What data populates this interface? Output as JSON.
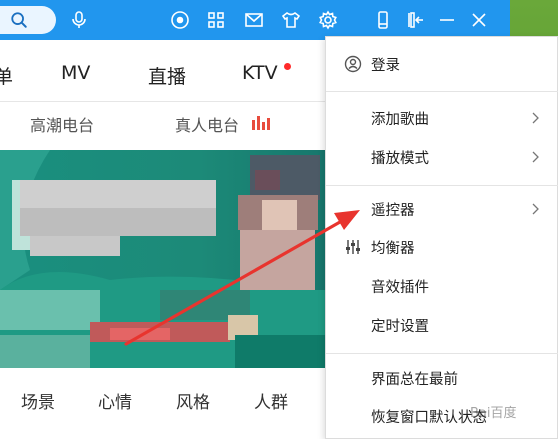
{
  "topbar": {
    "icons": [
      "search-icon",
      "mic-icon",
      "play-circle-icon",
      "grid-apps-icon",
      "mail-icon",
      "tshirt-skin-icon",
      "gear-icon",
      "phone-icon",
      "mini-mode-icon",
      "minimize-icon",
      "close-icon"
    ]
  },
  "nav": {
    "items": [
      "单",
      "MV",
      "直播",
      "KTV"
    ]
  },
  "subnav": {
    "items": [
      "高潮电台",
      "真人电台"
    ]
  },
  "tags": {
    "items": [
      "场景",
      "心情",
      "风格",
      "人群"
    ]
  },
  "menu": {
    "login": "登录",
    "add_song": "添加歌曲",
    "play_mode": "播放模式",
    "remote": "遥控器",
    "equalizer": "均衡器",
    "effects": "音效插件",
    "timer": "定时设置",
    "always_on_top": "界面总在最前",
    "restore_window": "恢复窗口默认状态"
  },
  "colors": {
    "topbar": "#2196ee",
    "annotation": "#e8342e",
    "banner": "#1c8a78"
  },
  "watermark": "Bai百度"
}
